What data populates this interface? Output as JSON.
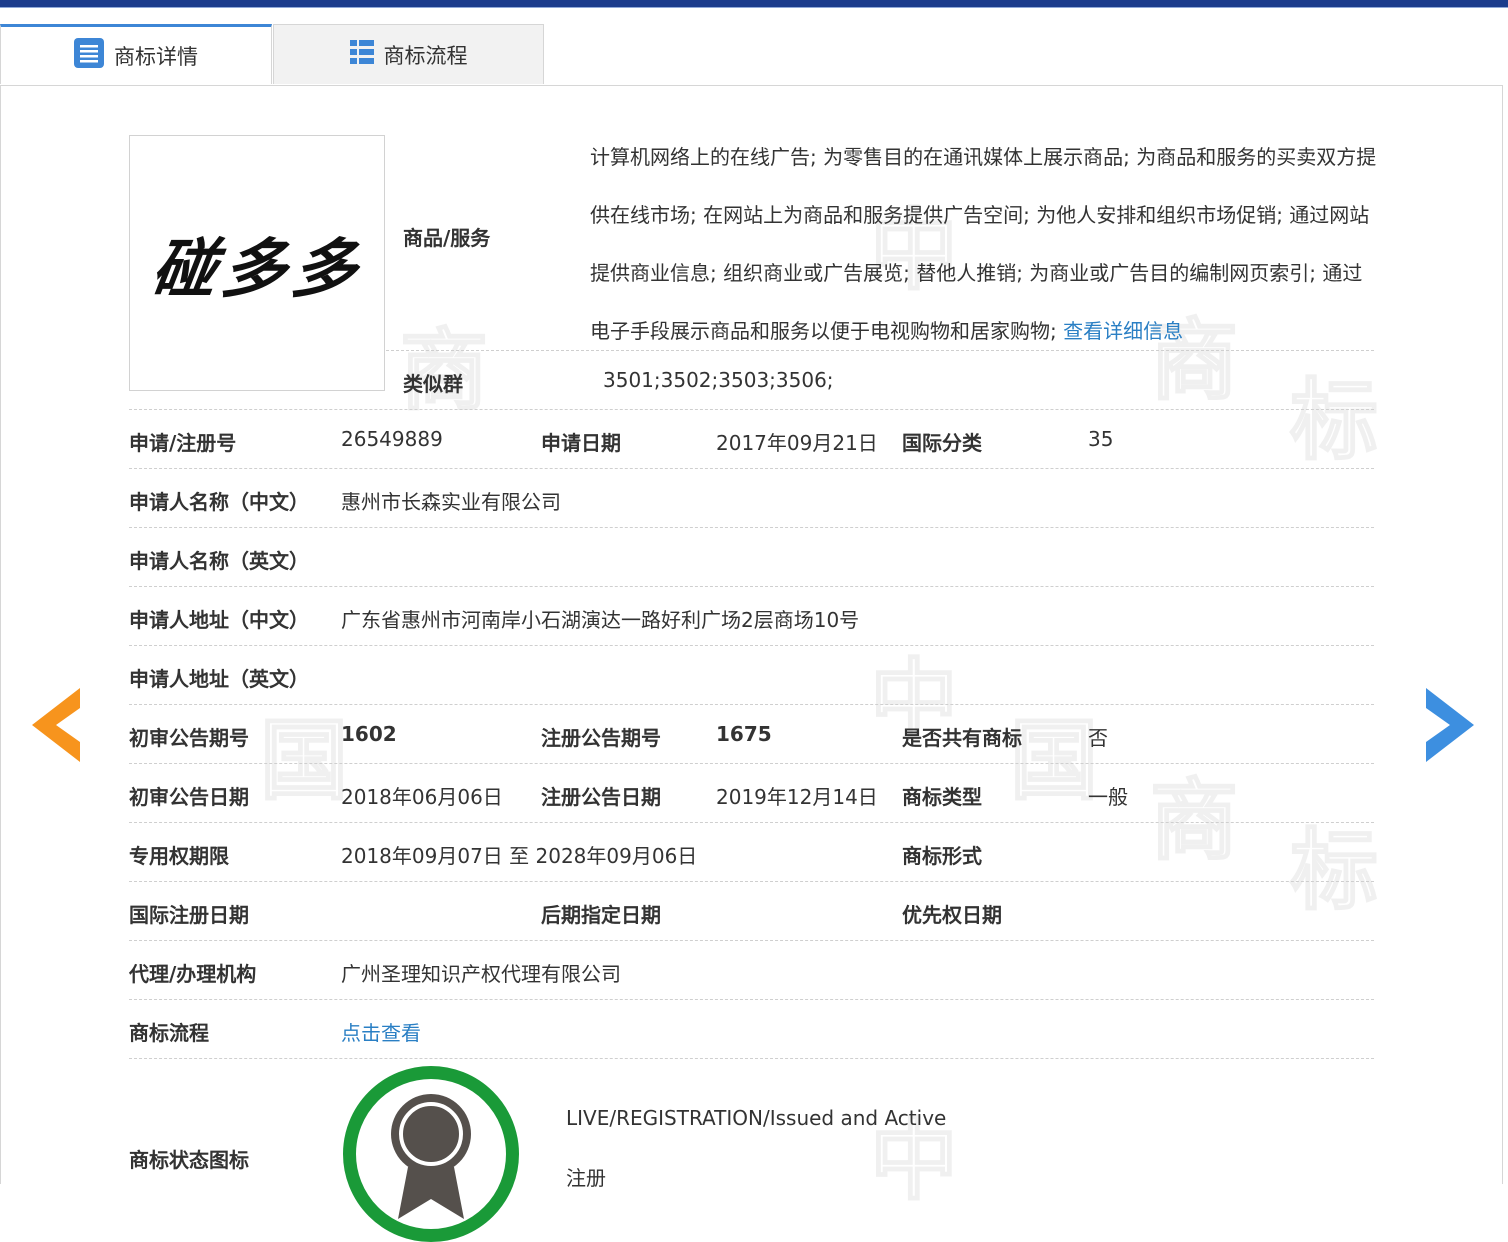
{
  "tabs": [
    {
      "label": "商标详情",
      "icon": "list-icon",
      "active": true
    },
    {
      "label": "商标流程",
      "icon": "table-icon",
      "active": false
    }
  ],
  "mark": {
    "image_text": "碰多多"
  },
  "goods": {
    "label": "商品/服务",
    "text": "计算机网络上的在线广告; 为零售目的在通讯媒体上展示商品; 为商品和服务的买卖双方提供在线市场; 在网站上为商品和服务提供广告空间; 为他人安排和组织市场促销; 通过网站提供商业信息; 组织商业或广告展览; 替他人推销; 为商业或广告目的编制网页索引; 通过电子手段展示商品和服务以便于电视购物和居家购物;",
    "link": "查看详细信息"
  },
  "similar_group": {
    "label": "类似群",
    "value": "3501;3502;3503;3506;"
  },
  "fields": {
    "reg_no_label": "申请/注册号",
    "reg_no": "26549889",
    "apply_date_label": "申请日期",
    "apply_date": "2017年09月21日",
    "intl_class_label": "国际分类",
    "intl_class": "35",
    "applicant_cn_label": "申请人名称（中文）",
    "applicant_cn": "惠州市长森实业有限公司",
    "applicant_en_label": "申请人名称（英文）",
    "applicant_en": "",
    "address_cn_label": "申请人地址（中文）",
    "address_cn": "广东省惠州市河南岸小石湖演达一路好利广场2层商场10号",
    "address_en_label": "申请人地址（英文）",
    "address_en": "",
    "prelim_no_label": "初审公告期号",
    "prelim_no": "1602",
    "reg_pub_no_label": "注册公告期号",
    "reg_pub_no": "1675",
    "shared_label": "是否共有商标",
    "shared": "否",
    "prelim_date_label": "初审公告日期",
    "prelim_date": "2018年06月06日",
    "reg_pub_date_label": "注册公告日期",
    "reg_pub_date": "2019年12月14日",
    "mark_type_label": "商标类型",
    "mark_type": "一般",
    "exclusive_label": "专用权期限",
    "exclusive": "2018年09月07日 至 2028年09月06日",
    "mark_form_label": "商标形式",
    "mark_form": "",
    "intl_reg_date_label": "国际注册日期",
    "intl_reg_date": "",
    "later_date_label": "后期指定日期",
    "later_date": "",
    "priority_date_label": "优先权日期",
    "priority_date": "",
    "agent_label": "代理/办理机构",
    "agent": "广州圣理知识产权代理有限公司",
    "flow_label": "商标流程",
    "flow_link": "点击查看",
    "status_label": "商标状态图标",
    "status_en": "LIVE/REGISTRATION/Issued and Active",
    "status_cn": "注册"
  },
  "colors": {
    "accent": "#3d86d6",
    "link": "#2a7fc4",
    "prev_arrow": "#f7941d",
    "next_arrow": "#3d8fe0",
    "seal_ring": "#1a9a38"
  }
}
